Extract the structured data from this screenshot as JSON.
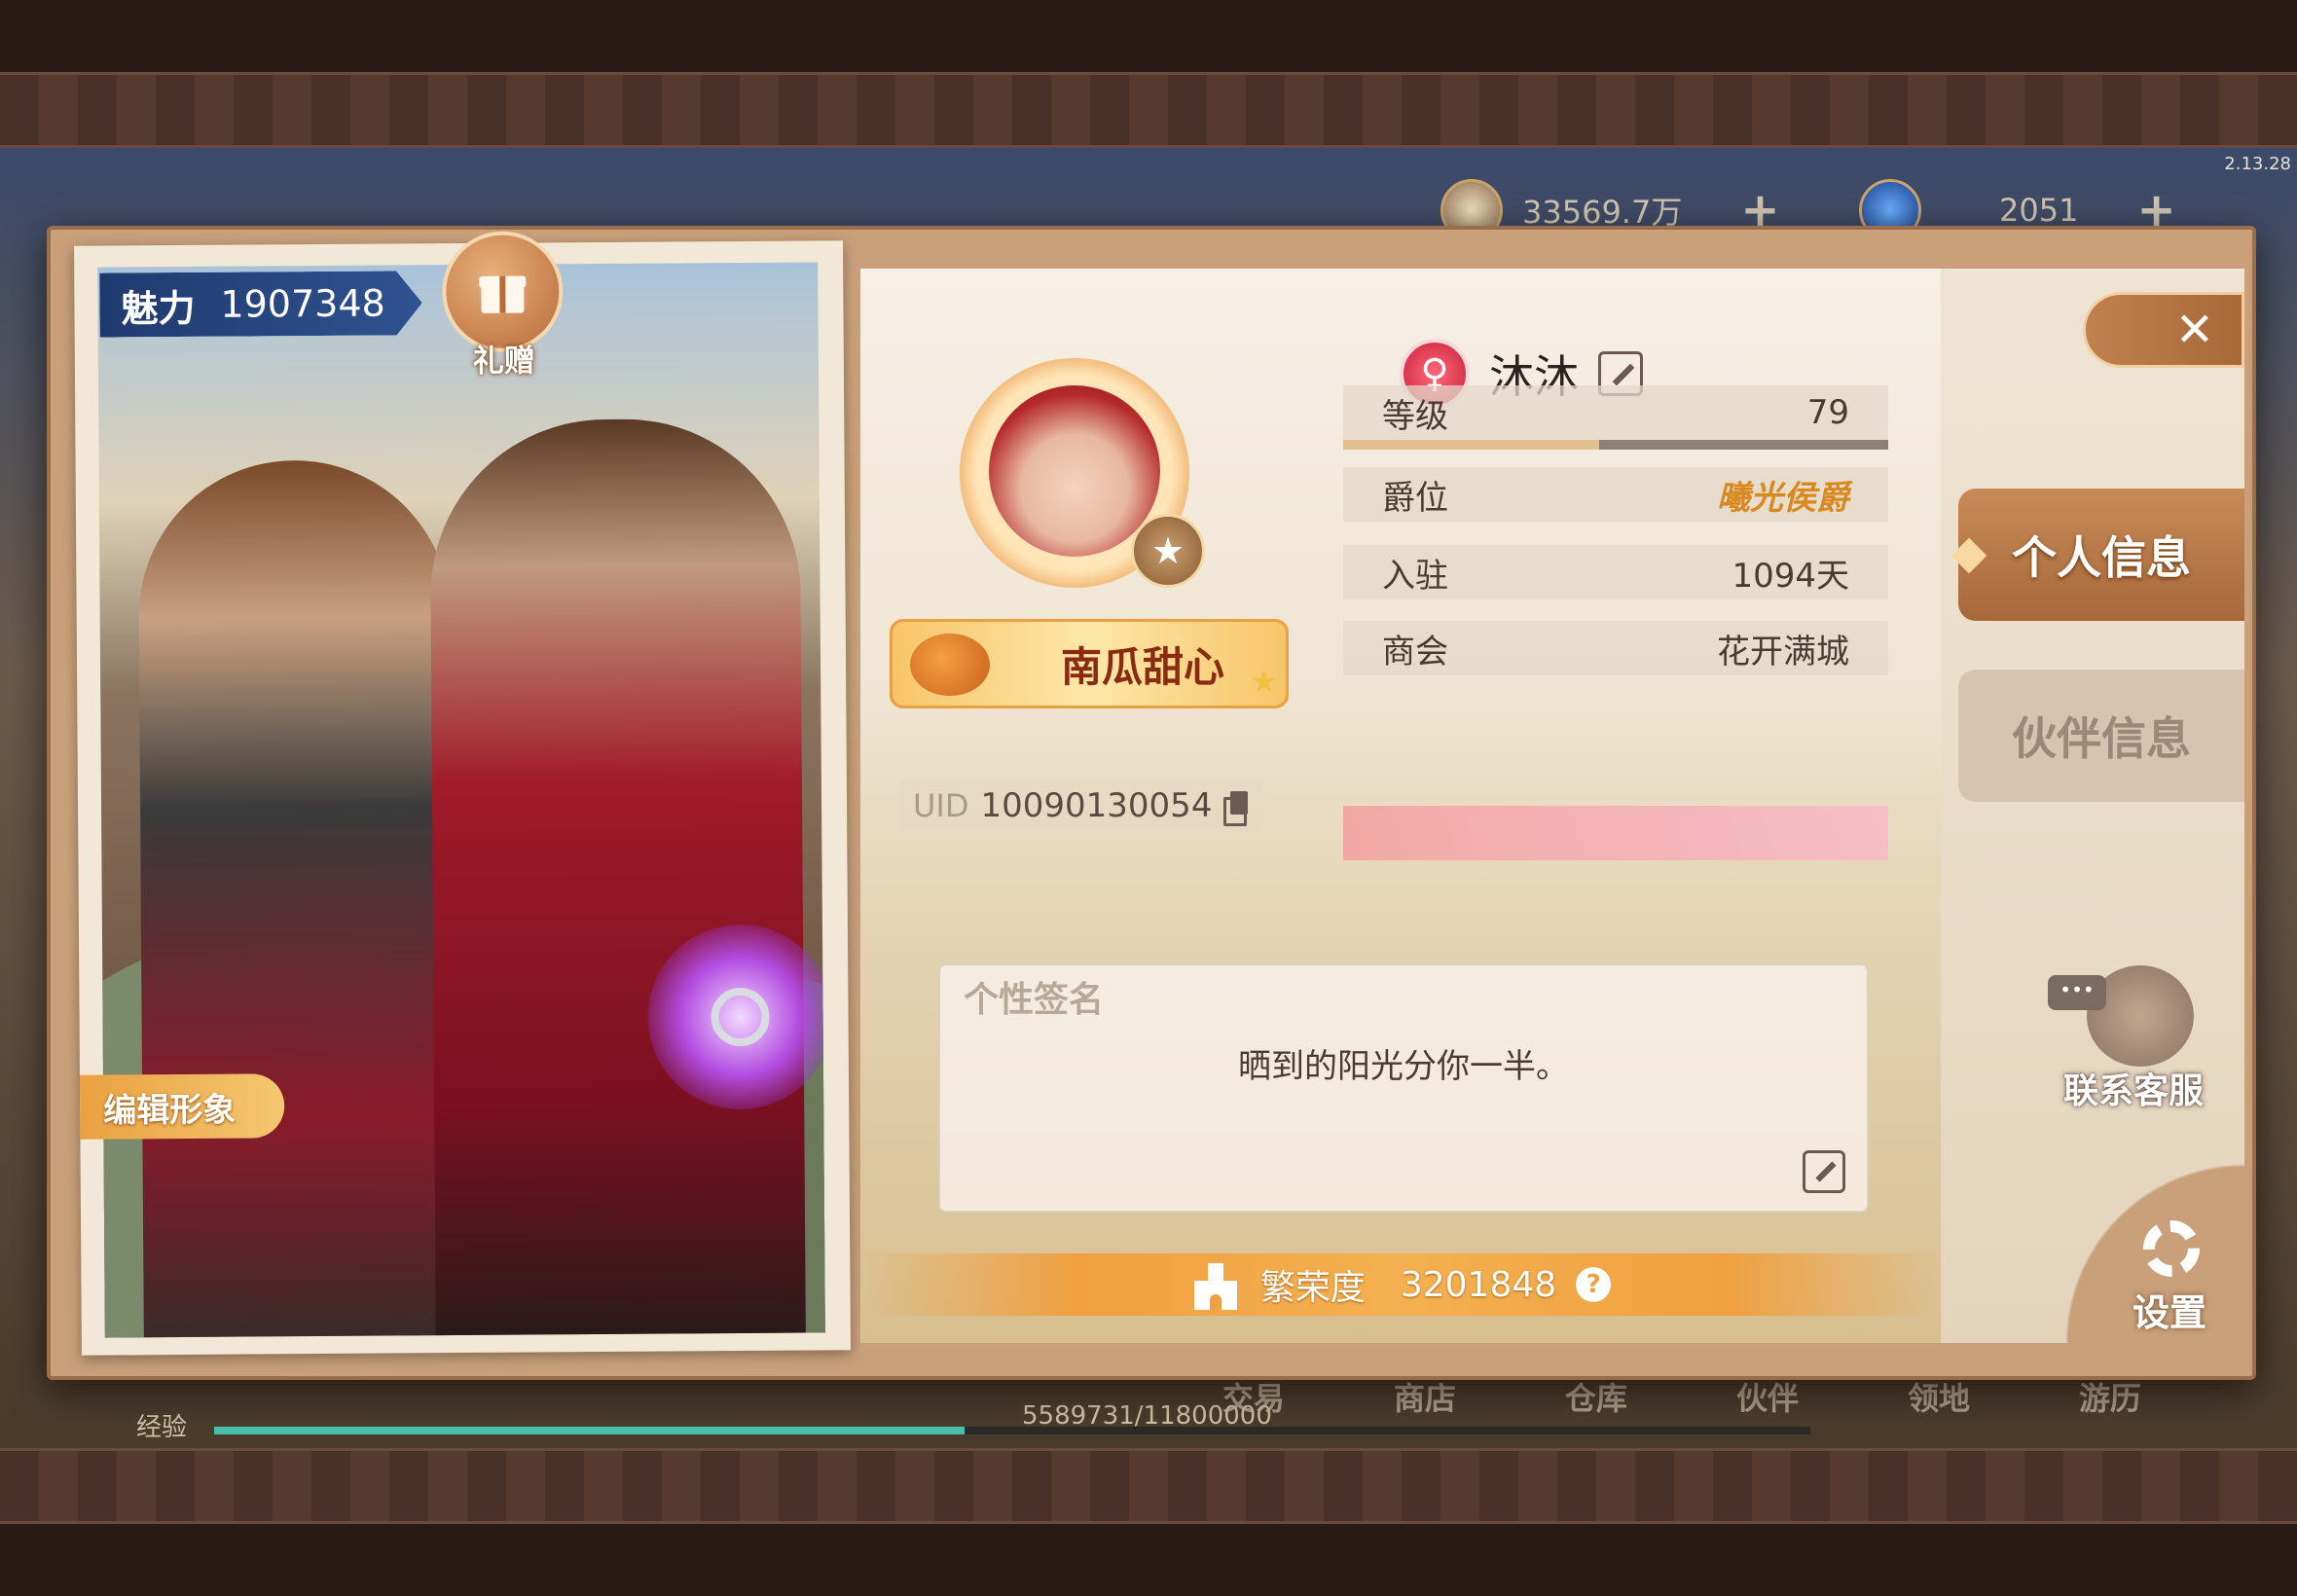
{
  "version": "2.13.28",
  "hud": {
    "currency1_value": "33569.7万",
    "currency2_value": "2051",
    "plus_symbol": "+"
  },
  "bottom_nav": {
    "items": [
      "交易",
      "商店",
      "仓库",
      "伙伴",
      "领地",
      "游历"
    ],
    "exp_label": "经验",
    "exp_value": "5589731/11800000",
    "exp_progress": 0.47
  },
  "portrait": {
    "charm_label": "魅力",
    "charm_value": "1907348",
    "gift_label": "礼赠",
    "edit_look_label": "编辑形象"
  },
  "profile": {
    "name": "沐沐",
    "gender_icon": "female-icon",
    "title_badge": "南瓜甜心",
    "uid_label": "UID",
    "uid_value": "10090130054",
    "rows": [
      {
        "key": "等级",
        "value": "79"
      },
      {
        "key": "爵位",
        "value": "曦光侯爵"
      },
      {
        "key": "入驻",
        "value": "1094天"
      },
      {
        "key": "商会",
        "value": "花开满城"
      }
    ],
    "level_progress": 0.47,
    "signature_title": "个性签名",
    "signature_text": "晒到的阳光分你一半。",
    "prosperity_label": "繁荣度",
    "prosperity_value": "3201848",
    "help_symbol": "?"
  },
  "side": {
    "close_symbol": "✕",
    "tabs": [
      {
        "label": "个人信息",
        "active": true
      },
      {
        "label": "伙伴信息",
        "active": false
      }
    ],
    "support_label": "联系客服",
    "settings_label": "设置"
  },
  "colors": {
    "accent_orange": "#f0a040",
    "tab_active": "#b8784a",
    "charm_blue": "#2f5290",
    "gender_pink": "#e03a50"
  }
}
